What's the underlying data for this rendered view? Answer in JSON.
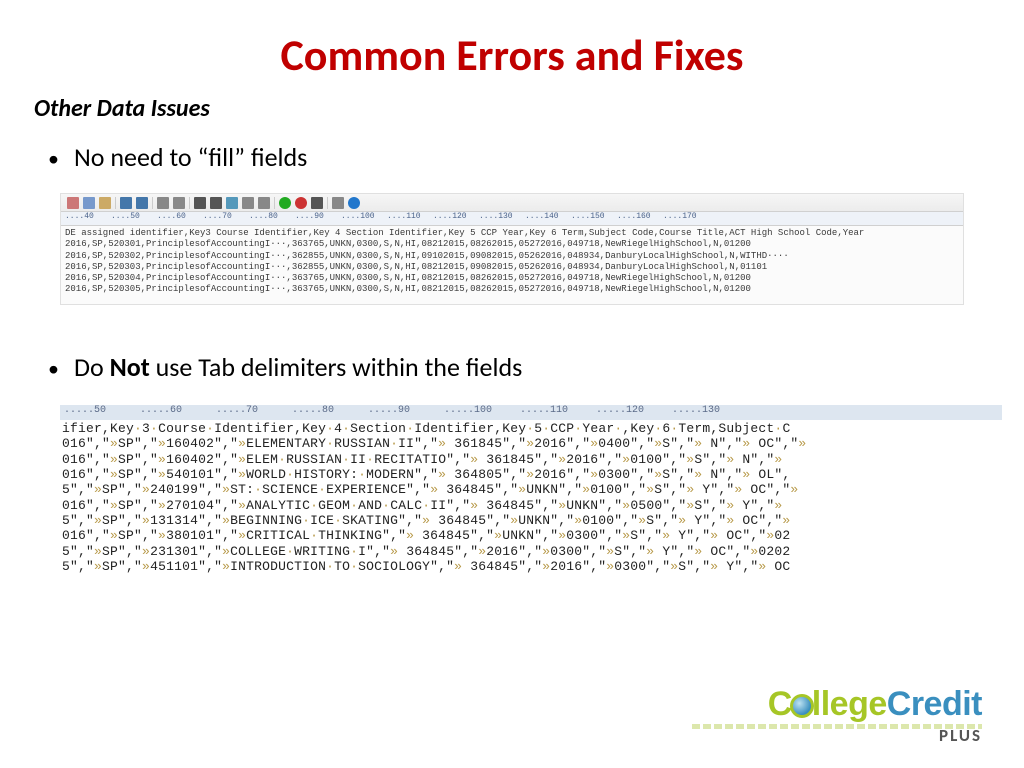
{
  "title": "Common Errors and Fixes",
  "section": "Other Data Issues",
  "bullet1_prefix": "No need to “fill” fields",
  "bullet2": {
    "pre": "Do ",
    "bold": "Not",
    "post": " use Tab delimiters within the fields"
  },
  "ruler1": [
    "40",
    "50",
    "60",
    "70",
    "80",
    "90",
    "100",
    "110",
    "120",
    "130",
    "140",
    "150",
    "160",
    "170"
  ],
  "editor1_lines": [
    "DE assigned identifier,Key3 Course Identifier,Key 4 Section Identifier,Key 5 CCP Year,Key 6 Term,Subject Code,Course Title,ACT High School Code,Year",
    "2016,SP,520301,PrinciplesofAccountingI···,363765,UNKN,0300,S,N,HI,08212015,08262015,05272016,049718,NewRiegelHighSchool,N,01200",
    "2016,SP,520302,PrinciplesofAccountingI···,362855,UNKN,0300,S,N,HI,09102015,09082015,05262016,048934,DanburyLocalHighSchool,N,WITHD····",
    "2016,SP,520303,PrinciplesofAccountingI···,362855,UNKN,0300,S,N,HI,08212015,09082015,05262016,048934,DanburyLocalHighSchool,N,01101",
    "2016,SP,520304,PrinciplesofAccountingI···,363765,UNKN,0300,S,N,HI,08212015,08262015,05272016,049718,NewRiegelHighSchool,N,01200",
    "2016,SP,520305,PrinciplesofAccountingI···,363765,UNKN,0300,S,N,HI,08212015,08262015,05272016,049718,NewRiegelHighSchool,N,01200"
  ],
  "ruler2": [
    "50",
    "60",
    "70",
    "80",
    "90",
    "100",
    "110",
    "120",
    "130"
  ],
  "editor2_lines": [
    "ifier,Key·3·Course·Identifier,Key·4·Section·Identifier,Key·5·CCP·Year·,Key·6·Term,Subject·C",
    "016\",\"»SP\",\"»160402\",\"»ELEMENTARY·RUSSIAN·II\",\"» 361845\",\"»2016\",\"»0400\",\"»S\",\"» N\",\"» OC\",\"»",
    "016\",\"»SP\",\"»160402\",\"»ELEM·RUSSIAN·II·RECITATIO\",\"» 361845\",\"»2016\",\"»0100\",\"»S\",\"» N\",\"»",
    "016\",\"»SP\",\"»540101\",\"»WORLD·HISTORY:·MODERN\",\"» 364805\",\"»2016\",\"»0300\",\"»S\",\"» N\",\"» OL\",",
    "5\",\"»SP\",\"»240199\",\"»ST:·SCIENCE·EXPERIENCE\",\"» 364845\",\"»UNKN\",\"»0100\",\"»S\",\"» Y\",\"» OC\",\"»",
    "016\",\"»SP\",\"»270104\",\"»ANALYTIC·GEOM·AND·CALC·II\",\"» 364845\",\"»UNKN\",\"»0500\",\"»S\",\"» Y\",\"»",
    "5\",\"»SP\",\"»131314\",\"»BEGINNING·ICE·SKATING\",\"» 364845\",\"»UNKN\",\"»0100\",\"»S\",\"» Y\",\"» OC\",\"»",
    "016\",\"»SP\",\"»380101\",\"»CRITICAL·THINKING\",\"» 364845\",\"»UNKN\",\"»0300\",\"»S\",\"» Y\",\"» OC\",\"»02",
    "5\",\"»SP\",\"»231301\",\"»COLLEGE·WRITING·I\",\"» 364845\",\"»2016\",\"»0300\",\"»S\",\"» Y\",\"» OC\",\"»0202",
    "5\",\"»SP\",\"»451101\",\"»INTRODUCTION·TO·SOCIOLOGY\",\"» 364845\",\"»2016\",\"»0300\",\"»S\",\"» Y\",\"» OC"
  ],
  "toolbar_icons": [
    "cut",
    "copy",
    "paste",
    "sep",
    "undo",
    "redo",
    "sep",
    "toggle-1",
    "toggle-2",
    "sep",
    "find",
    "replace",
    "bookmark",
    "bookmark-next",
    "bookmark-prev",
    "sep",
    "record",
    "play",
    "stop",
    "sep",
    "settings",
    "help"
  ],
  "logo": {
    "left": "C",
    "mid": "llege",
    "right": "Credit",
    "sub": "PLUS"
  }
}
